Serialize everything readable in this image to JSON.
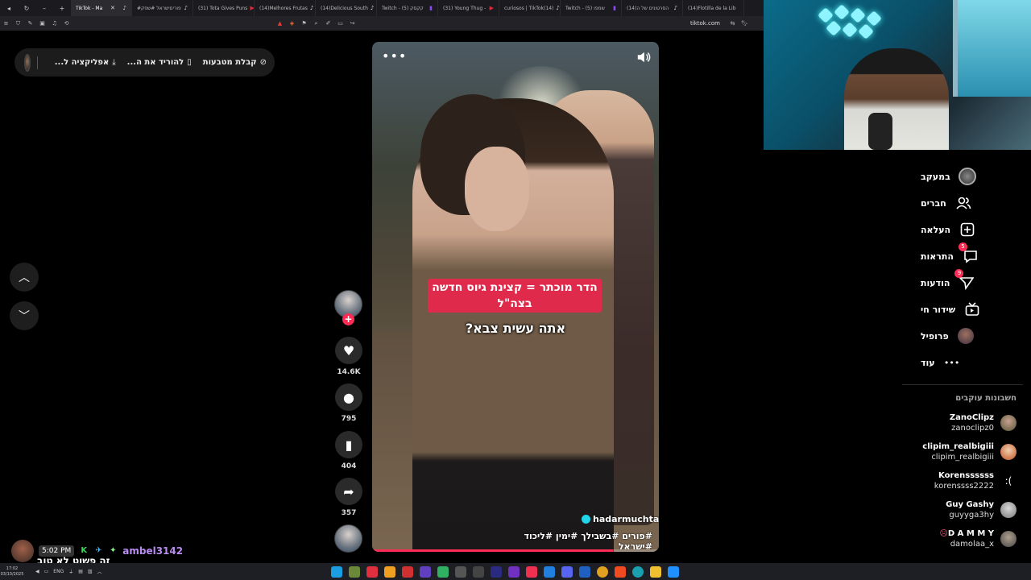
{
  "browser": {
    "tabs": [
      {
        "label": "TikTok - Ma",
        "icon": "tiktok-icon",
        "active": true
      },
      {
        "label": "#פוריםישראל #שפק",
        "icon": "tiktok-icon",
        "active": false
      },
      {
        "label": "(31) Tota Gives Puns",
        "icon": "youtube-icon",
        "active": false
      },
      {
        "label": "(14)Melhores Frutas",
        "icon": "tiktok-icon",
        "active": false
      },
      {
        "label": "(14)Delicious South",
        "icon": "tiktok-icon",
        "active": false
      },
      {
        "label": "Twitch - קקסק (5)",
        "icon": "twitch-icon",
        "active": false
      },
      {
        "label": "(31) Young Thug -",
        "icon": "youtube-icon",
        "active": false
      },
      {
        "label": "curiosos | TikTok(14)",
        "icon": "tiktok-icon",
        "active": false
      },
      {
        "label": "Twitch - שמפו (5)",
        "icon": "twitch-icon",
        "active": false
      },
      {
        "label": "(14)הסרטונים של ה",
        "icon": "tiktok-icon",
        "active": false
      },
      {
        "label": "(14)Flotilla de la Lib",
        "icon": "tiktok-icon",
        "active": false
      }
    ],
    "url": "tiktok.com"
  },
  "topbar": {
    "get_coins": "קבלת מטבעות",
    "download_app": "להוריד את ה...",
    "app": "אפליקציה ל..."
  },
  "video": {
    "caption_title": "הדר מוכתר = קצינת גיוס חדשה בצה\"ל",
    "caption_question": "אתה עשית צבא?",
    "username": "hadarmuchtar",
    "hashtags": "#פורים #בשבילך #ימין #ליכוד #ישראל",
    "progress": 0.84
  },
  "actions": {
    "likes": "14.6K",
    "comments": "795",
    "saves": "404",
    "shares": "357"
  },
  "sidebar": {
    "items": [
      {
        "label": "במעקב",
        "icon": "following-avatar-icon"
      },
      {
        "label": "חברים",
        "icon": "friends-icon"
      },
      {
        "label": "העלאה",
        "icon": "upload-icon"
      },
      {
        "label": "התראות",
        "icon": "inbox-icon",
        "badge": "5"
      },
      {
        "label": "הודעות",
        "icon": "messages-icon",
        "badge": "9"
      },
      {
        "label": "שידור חי",
        "icon": "live-icon"
      },
      {
        "label": "פרופיל",
        "icon": "profile-avatar-icon"
      },
      {
        "label": "עוד",
        "icon": "more-icon"
      }
    ],
    "following_header": "חשבונות עוקבים",
    "following": [
      {
        "name": "ZanoClipz",
        "handle": "zanoclipz0"
      },
      {
        "name": "clipim_realbigiii",
        "handle": "clipim_realbigiii"
      },
      {
        "name": "Korenssssss",
        "handle": "korenssss2222"
      },
      {
        "name": "Guy Gashy",
        "handle": "guyyga3hy"
      },
      {
        "name": "D A M M Y",
        "handle": "damolaa_x"
      }
    ]
  },
  "chat": {
    "time": "5:02 PM",
    "user": "ambel3142",
    "message": "זה פשוט לא טוב"
  },
  "taskbar": {
    "clock": "17:02",
    "date": "03/10/2025",
    "lang": "ENG"
  }
}
